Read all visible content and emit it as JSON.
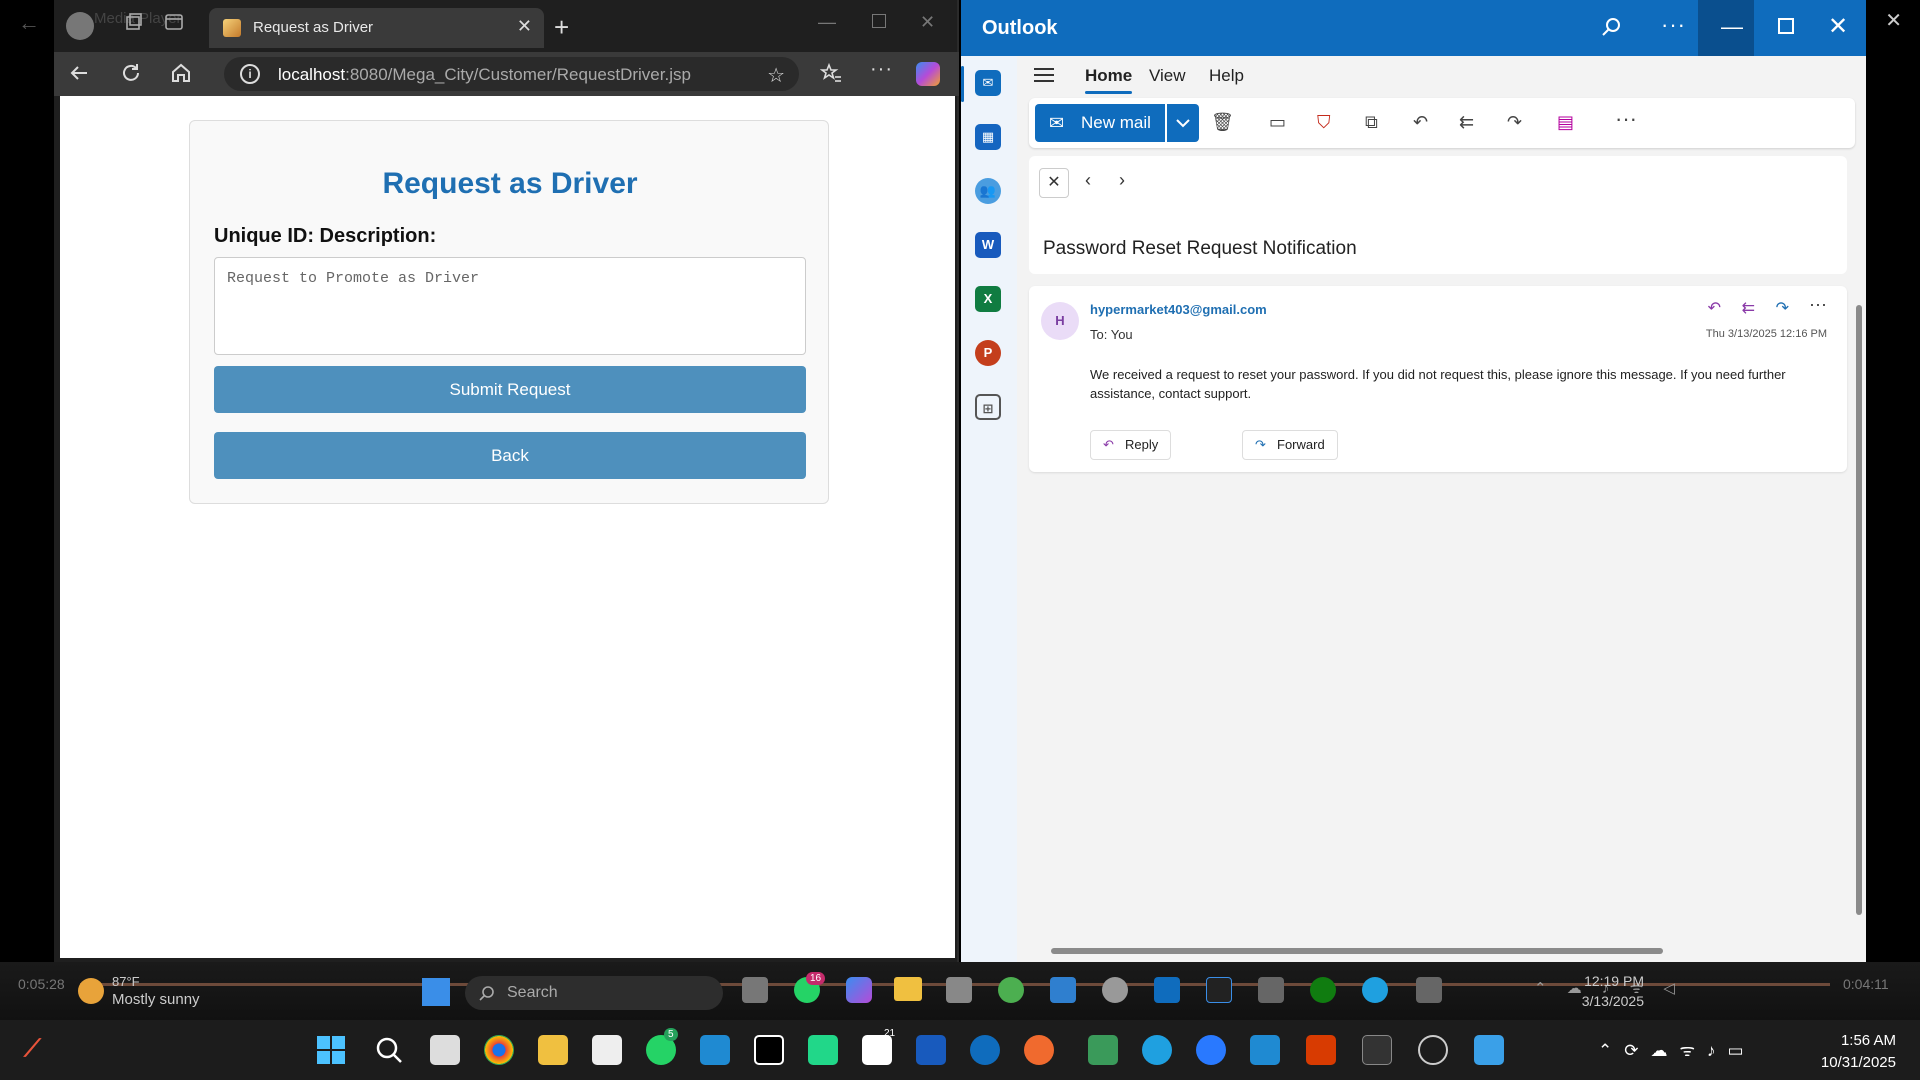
{
  "media_player": {
    "title": "Media Player",
    "time_elapsed": "0:05:28",
    "time_remaining": "0:04:11"
  },
  "browser": {
    "tab_title": "Request as Driver",
    "url_host": "localhost",
    "url_rest": ":8080/Mega_City/Customer/RequestDriver.jsp"
  },
  "request_page": {
    "heading": "Request as Driver",
    "field_label": "Unique ID: Description:",
    "textarea_placeholder": "Request to Promote as Driver",
    "submit_label": "Submit Request",
    "back_label": "Back",
    "accent_color": "#1f6fb2",
    "button_color": "#4e90bd"
  },
  "outlook": {
    "app_name": "Outlook",
    "tabs": [
      "Home",
      "View",
      "Help"
    ],
    "new_mail_label": "New mail",
    "subject": "Password Reset Request Notification",
    "message": {
      "avatar_initial": "H",
      "sender": "hypermarket403@gmail.com",
      "to": "To:  You",
      "date": "Thu 3/13/2025 12:16 PM",
      "body": "We received a request to reset your password. If you did not request this, please ignore this message. If you need further assistance, contact support.",
      "reply_label": "Reply",
      "forward_label": "Forward"
    },
    "brand_color": "#0f6cbd"
  },
  "inner_taskbar": {
    "weather_temp": "87°F",
    "weather_desc": "Mostly sunny",
    "search_placeholder": "Search",
    "time": "12:19 PM",
    "date": "3/13/2025",
    "badges": {
      "whatsapp": "16"
    }
  },
  "taskbar": {
    "time": "1:56 AM",
    "date": "10/31/2025",
    "badges": {
      "whatsapp": "5",
      "notes": "21"
    }
  }
}
